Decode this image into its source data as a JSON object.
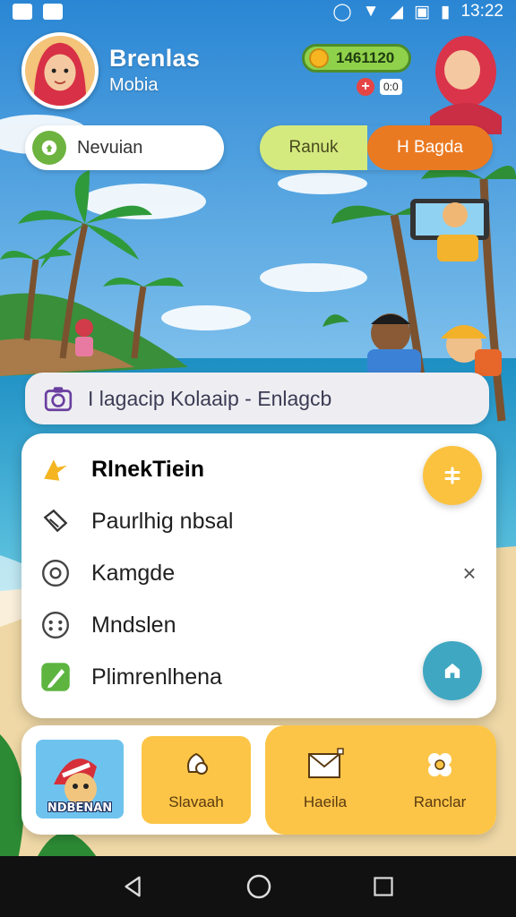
{
  "status_bar": {
    "time": "13:22"
  },
  "header": {
    "title": "Brenlas",
    "subtitle": "Mobia",
    "coins": "1461120",
    "badge_tag": "0:0"
  },
  "top_pills": {
    "nav_label": "Nevuian",
    "segment_a": "Ranuk",
    "segment_b": "H Bagda"
  },
  "search": {
    "text": "I lagacip Kolaaip - Enlagcb"
  },
  "menu": {
    "items": [
      {
        "label": "RlnekTiein",
        "icon": "sparkle-icon"
      },
      {
        "label": "Paurlhig nbsal",
        "icon": "ticket-icon"
      },
      {
        "label": "Kamgde",
        "icon": "circle-icon"
      },
      {
        "label": "Mndslen",
        "icon": "dots-icon"
      },
      {
        "label": "Plimrenlhena",
        "icon": "pencil-icon"
      }
    ]
  },
  "dock": {
    "image_label": "NDBENAN",
    "tiles": [
      {
        "label": "Slavaah",
        "icon": "bell-icon"
      },
      {
        "label": "Haeila",
        "icon": "mail-icon"
      },
      {
        "label": "Ranclar",
        "icon": "flower-icon"
      }
    ]
  },
  "colors": {
    "accent_orange": "#ea7a22",
    "tile_yellow": "#fcc547",
    "fab_teal": "#3fa7c2",
    "green": "#6db33f"
  }
}
